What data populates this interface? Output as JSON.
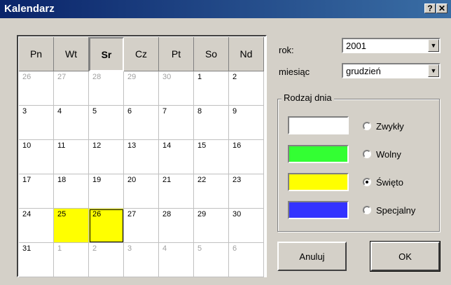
{
  "window": {
    "title": "Kalendarz",
    "help_label": "?",
    "close_label": "✕"
  },
  "calendar": {
    "headers": [
      "Pn",
      "Wt",
      "Sr",
      "Cz",
      "Pt",
      "So",
      "Nd"
    ],
    "today_header_index": 2,
    "weeks": [
      [
        {
          "d": "26",
          "o": true
        },
        {
          "d": "27",
          "o": true
        },
        {
          "d": "28",
          "o": true
        },
        {
          "d": "29",
          "o": true
        },
        {
          "d": "30",
          "o": true
        },
        {
          "d": "1"
        },
        {
          "d": "2"
        }
      ],
      [
        {
          "d": "3"
        },
        {
          "d": "4"
        },
        {
          "d": "5"
        },
        {
          "d": "6"
        },
        {
          "d": "7"
        },
        {
          "d": "8"
        },
        {
          "d": "9"
        }
      ],
      [
        {
          "d": "10"
        },
        {
          "d": "11"
        },
        {
          "d": "12"
        },
        {
          "d": "13"
        },
        {
          "d": "14"
        },
        {
          "d": "15"
        },
        {
          "d": "16"
        }
      ],
      [
        {
          "d": "17"
        },
        {
          "d": "18"
        },
        {
          "d": "19"
        },
        {
          "d": "20"
        },
        {
          "d": "21"
        },
        {
          "d": "22"
        },
        {
          "d": "23"
        }
      ],
      [
        {
          "d": "24"
        },
        {
          "d": "25",
          "h": true
        },
        {
          "d": "26",
          "h": true,
          "s": true
        },
        {
          "d": "27"
        },
        {
          "d": "28"
        },
        {
          "d": "29"
        },
        {
          "d": "30"
        }
      ],
      [
        {
          "d": "31"
        },
        {
          "d": "1",
          "o": true
        },
        {
          "d": "2",
          "o": true
        },
        {
          "d": "3",
          "o": true
        },
        {
          "d": "4",
          "o": true
        },
        {
          "d": "5",
          "o": true
        },
        {
          "d": "6",
          "o": true
        }
      ]
    ]
  },
  "year": {
    "label": "rok:",
    "value": "2001"
  },
  "month": {
    "label": "miesiąc",
    "value": "grudzień"
  },
  "day_type": {
    "legend": "Rodzaj dnia",
    "options": [
      {
        "label": "Zwykły",
        "color": "#ffffff",
        "checked": false
      },
      {
        "label": "Wolny",
        "color": "#33ff33",
        "checked": false
      },
      {
        "label": "Święto",
        "color": "#ffff00",
        "checked": true
      },
      {
        "label": "Specjalny",
        "color": "#3333ff",
        "checked": false
      }
    ]
  },
  "buttons": {
    "cancel": "Anuluj",
    "ok": "OK"
  },
  "colors": {
    "title_bar": "#0a246a",
    "holiday": "#ffff00"
  }
}
